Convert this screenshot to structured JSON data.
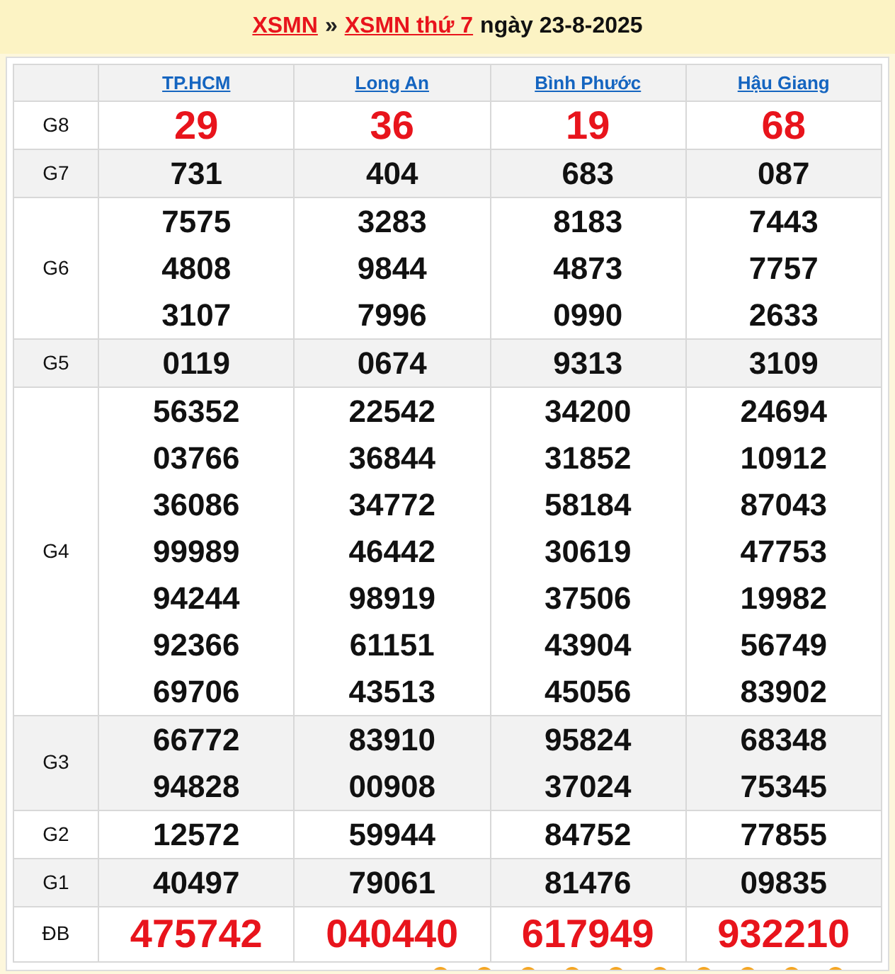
{
  "header": {
    "links": [
      "XSMN",
      "XSMN thứ 7"
    ],
    "separator": "»",
    "date_text": "ngày 23-8-2025"
  },
  "provinces": [
    "TP.HCM",
    "Long An",
    "Bình Phước",
    "Hậu Giang"
  ],
  "prizes": [
    {
      "label": "G8",
      "kind": "large",
      "values": [
        [
          "29"
        ],
        [
          "36"
        ],
        [
          "19"
        ],
        [
          "68"
        ]
      ]
    },
    {
      "label": "G7",
      "kind": "normal",
      "values": [
        [
          "731"
        ],
        [
          "404"
        ],
        [
          "683"
        ],
        [
          "087"
        ]
      ]
    },
    {
      "label": "G6",
      "kind": "normal",
      "values": [
        [
          "7575",
          "4808",
          "3107"
        ],
        [
          "3283",
          "9844",
          "7996"
        ],
        [
          "8183",
          "4873",
          "0990"
        ],
        [
          "7443",
          "7757",
          "2633"
        ]
      ]
    },
    {
      "label": "G5",
      "kind": "normal",
      "values": [
        [
          "0119"
        ],
        [
          "0674"
        ],
        [
          "9313"
        ],
        [
          "3109"
        ]
      ]
    },
    {
      "label": "G4",
      "kind": "normal",
      "values": [
        [
          "56352",
          "03766",
          "36086",
          "99989",
          "94244",
          "92366",
          "69706"
        ],
        [
          "22542",
          "36844",
          "34772",
          "46442",
          "98919",
          "61151",
          "43513"
        ],
        [
          "34200",
          "31852",
          "58184",
          "30619",
          "37506",
          "43904",
          "45056"
        ],
        [
          "24694",
          "10912",
          "87043",
          "47753",
          "19982",
          "56749",
          "83902"
        ]
      ]
    },
    {
      "label": "G3",
      "kind": "normal",
      "values": [
        [
          "66772",
          "94828"
        ],
        [
          "83910",
          "00908"
        ],
        [
          "95824",
          "37024"
        ],
        [
          "68348",
          "75345"
        ]
      ]
    },
    {
      "label": "G2",
      "kind": "normal",
      "values": [
        [
          "12572"
        ],
        [
          "59944"
        ],
        [
          "84752"
        ],
        [
          "77855"
        ]
      ]
    },
    {
      "label": "G1",
      "kind": "normal",
      "values": [
        [
          "40497"
        ],
        [
          "79061"
        ],
        [
          "81476"
        ],
        [
          "09835"
        ]
      ]
    },
    {
      "label": "ĐB",
      "kind": "large",
      "values": [
        [
          "475742"
        ],
        [
          "040440"
        ],
        [
          "617949"
        ],
        [
          "932210"
        ]
      ]
    }
  ]
}
